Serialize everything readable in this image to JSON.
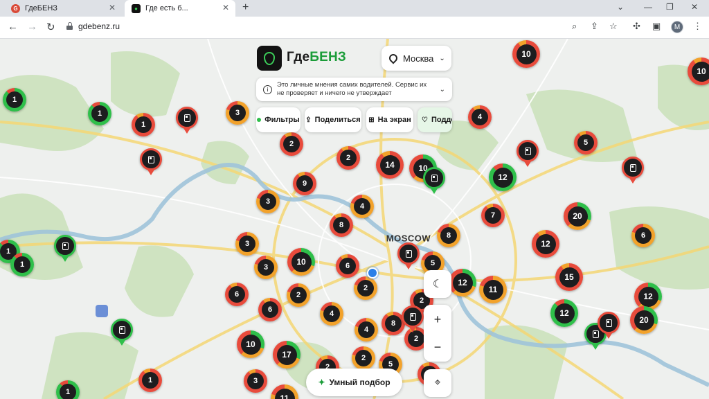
{
  "browser": {
    "tabs": [
      {
        "title": "ГдеБЕНЗ",
        "favicon": "G",
        "active": false
      },
      {
        "title": "Где есть б...",
        "favicon": "⛽",
        "active": true
      }
    ],
    "new_tab": "+",
    "url": "gdebenz.ru",
    "profile_initial": "M",
    "controls": [
      "minimize-icon",
      "restore-icon",
      "close-icon"
    ]
  },
  "app": {
    "brand_part1": "Где",
    "brand_part2": "БЕНЗ",
    "brand_color": "#1a9c38",
    "city": "Москва",
    "notice": "Это личные мнения самих водителей. Сервис их не проверяет и ничего не утверждает",
    "buttons": {
      "filters": "Фильтры",
      "share": "Поделиться",
      "to_screen": "На экран",
      "support": "Подде"
    },
    "smart_pick": "Умный подбор",
    "zoom_in": "+",
    "zoom_out": "−"
  },
  "map": {
    "city_label": "MOSCOW",
    "status_colors": {
      "green": "#2fbf4a",
      "red": "#e84b3c",
      "orange": "#f2a22b"
    },
    "clusters": [
      {
        "n": "1",
        "ring": "green"
      },
      {
        "n": "1",
        "ring": "green"
      },
      {
        "n": "1",
        "ring": "red"
      },
      {
        "n": "3",
        "ring": "orange"
      },
      {
        "n": "10",
        "ring": "red"
      },
      {
        "n": "2",
        "ring": "red"
      },
      {
        "n": "2",
        "ring": "red"
      },
      {
        "n": "14",
        "ring": "red"
      },
      {
        "n": "10",
        "ring": "mixed"
      },
      {
        "n": "4",
        "ring": "red"
      },
      {
        "n": "5",
        "ring": "red"
      },
      {
        "n": "9",
        "ring": "red"
      },
      {
        "n": "3",
        "ring": "orange"
      },
      {
        "n": "4",
        "ring": "orange"
      },
      {
        "n": "12",
        "ring": "green"
      },
      {
        "n": "8",
        "ring": "red"
      },
      {
        "n": "8",
        "ring": "orange"
      },
      {
        "n": "7",
        "ring": "red"
      },
      {
        "n": "20",
        "ring": "mixed"
      },
      {
        "n": "1",
        "ring": "green"
      },
      {
        "n": "1",
        "ring": "green"
      },
      {
        "n": "3",
        "ring": "orange"
      },
      {
        "n": "3",
        "ring": "orange"
      },
      {
        "n": "10",
        "ring": "mixed"
      },
      {
        "n": "6",
        "ring": "orange"
      },
      {
        "n": "5",
        "ring": "orange"
      },
      {
        "n": "12",
        "ring": "red"
      },
      {
        "n": "6",
        "ring": "red"
      },
      {
        "n": "2",
        "ring": "orange"
      },
      {
        "n": "12",
        "ring": "mixed"
      },
      {
        "n": "11",
        "ring": "orange"
      },
      {
        "n": "15",
        "ring": "red"
      },
      {
        "n": "6",
        "ring": "red"
      },
      {
        "n": "2",
        "ring": "orange"
      },
      {
        "n": "6",
        "ring": "red"
      },
      {
        "n": "4",
        "ring": "orange"
      },
      {
        "n": "12",
        "ring": "mixed"
      },
      {
        "n": "12",
        "ring": "green"
      },
      {
        "n": "4",
        "ring": "orange"
      },
      {
        "n": "8",
        "ring": "red"
      },
      {
        "n": "2",
        "ring": "red"
      },
      {
        "n": "20",
        "ring": "mixed"
      },
      {
        "n": "10",
        "ring": "mixed"
      },
      {
        "n": "17",
        "ring": "mixed"
      },
      {
        "n": "2",
        "ring": "orange"
      },
      {
        "n": "5",
        "ring": "orange"
      },
      {
        "n": "1",
        "ring": "red"
      },
      {
        "n": "3",
        "ring": "red"
      },
      {
        "n": "1",
        "ring": "green"
      },
      {
        "n": "2",
        "ring": "red"
      },
      {
        "n": "10",
        "ring": "red"
      },
      {
        "n": "2",
        "ring": "red"
      },
      {
        "n": "6",
        "ring": "red"
      },
      {
        "n": "11",
        "ring": "orange"
      }
    ],
    "pins": [
      {
        "status": "red"
      },
      {
        "status": "red"
      },
      {
        "status": "green"
      },
      {
        "status": "green"
      },
      {
        "status": "green"
      },
      {
        "status": "red"
      },
      {
        "status": "red"
      },
      {
        "status": "red"
      },
      {
        "status": "red"
      },
      {
        "status": "green"
      },
      {
        "status": "red"
      }
    ]
  }
}
